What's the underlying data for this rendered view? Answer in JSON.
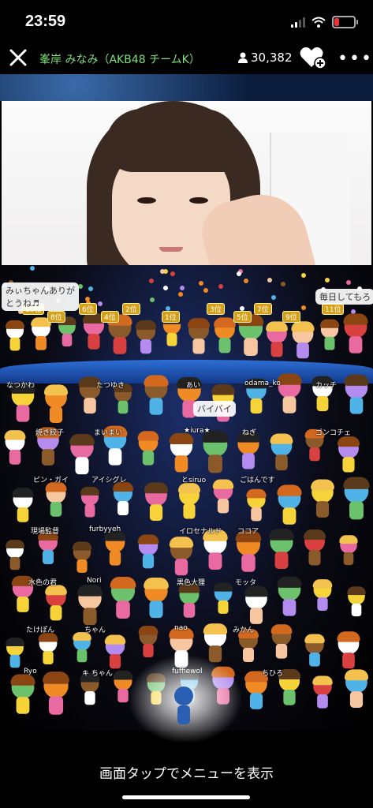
{
  "status": {
    "time": "23:59"
  },
  "header": {
    "room_title": "峯岸 みなみ（AKB48 チームK）",
    "viewer_count": "30,382",
    "more_label": "•••"
  },
  "comments": [
    "みぃちゃんありが\nとうね♬",
    "毎日してもろ",
    "バイバイ"
  ],
  "ranks": [
    "10位",
    "8位",
    "6位",
    "4位",
    "2位",
    "1位",
    "3位",
    "5位",
    "7位",
    "9位",
    "11位"
  ],
  "viewer_names": [
    "なつかわ",
    "焼き餃子",
    "ピン・ガイ",
    "現場監督",
    "水色の君",
    "たけぽん",
    "Ryo",
    "たつゆき",
    "まいまい",
    "アイシグレ",
    "furbyyeh",
    "Nori",
    "ちゃん",
    "キ ちゃん",
    "あい",
    "★iura★",
    "とsiruo",
    "イロセナルド",
    "黒色大狸",
    "nao",
    "fuffiewol",
    "odama_ko",
    "ねぎ",
    "ごはんです",
    "ココア",
    "モッタ",
    "みかん",
    "ちひろ",
    "カッチ",
    "ゴンコチェ"
  ],
  "footer": {
    "hint": "画面タップでメニューを表示"
  }
}
